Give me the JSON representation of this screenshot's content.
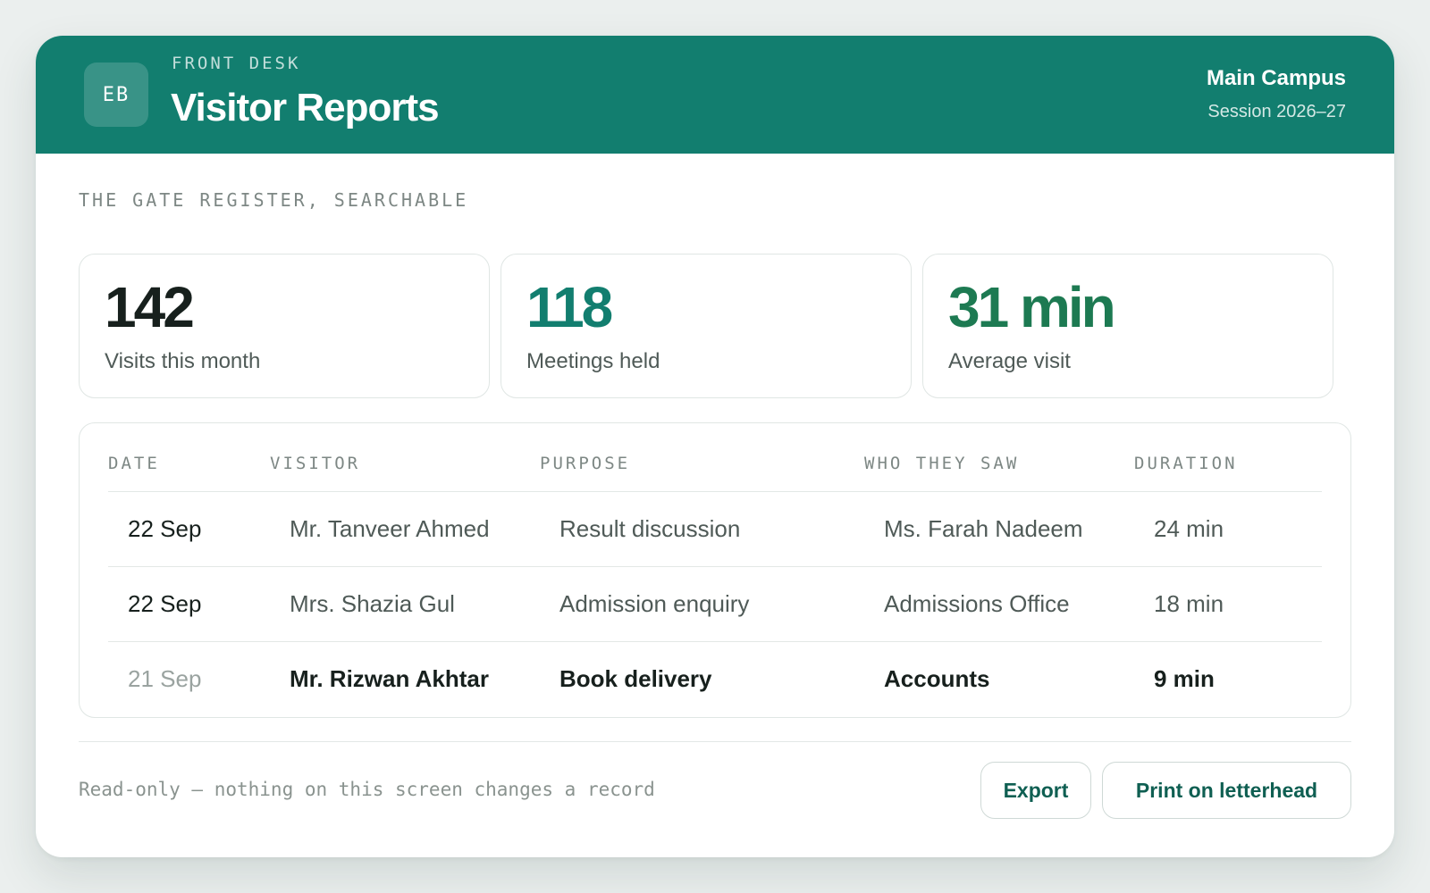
{
  "header": {
    "monogram": "EB",
    "eyebrow": "FRONT DESK",
    "title": "Visitor Reports",
    "campus": "Main Campus",
    "session": "Session 2026–27"
  },
  "subtitle": "THE GATE REGISTER, SEARCHABLE",
  "stats": [
    {
      "value": "142",
      "label": "Visits this month",
      "color": "#17201d"
    },
    {
      "value": "118",
      "label": "Meetings held",
      "color": "#127e6f"
    },
    {
      "value": "31 min",
      "label": "Average visit",
      "color": "#1d7a52"
    }
  ],
  "table": {
    "columns": [
      "DATE",
      "VISITOR",
      "PURPOSE",
      "WHO THEY SAW",
      "DURATION"
    ],
    "rows": [
      {
        "date": "22 Sep",
        "visitor": "Mr. Tanveer Ahmed",
        "purpose": "Result discussion",
        "seen": "Ms. Farah Nadeem",
        "duration": "24 min"
      },
      {
        "date": "22 Sep",
        "visitor": "Mrs. Shazia Gul",
        "purpose": "Admission enquiry",
        "seen": "Admissions Office",
        "duration": "18 min"
      },
      {
        "date": "21 Sep",
        "visitor": "Mr. Rizwan Akhtar",
        "purpose": "Book delivery",
        "seen": "Accounts",
        "duration": "9 min"
      }
    ]
  },
  "footer": {
    "note": "Read-only — nothing on this screen changes a record",
    "export_label": "Export",
    "print_label": "Print on letterhead"
  },
  "colors": {
    "header_bg": "#127e6f",
    "accent_text": "#0f5f52"
  }
}
